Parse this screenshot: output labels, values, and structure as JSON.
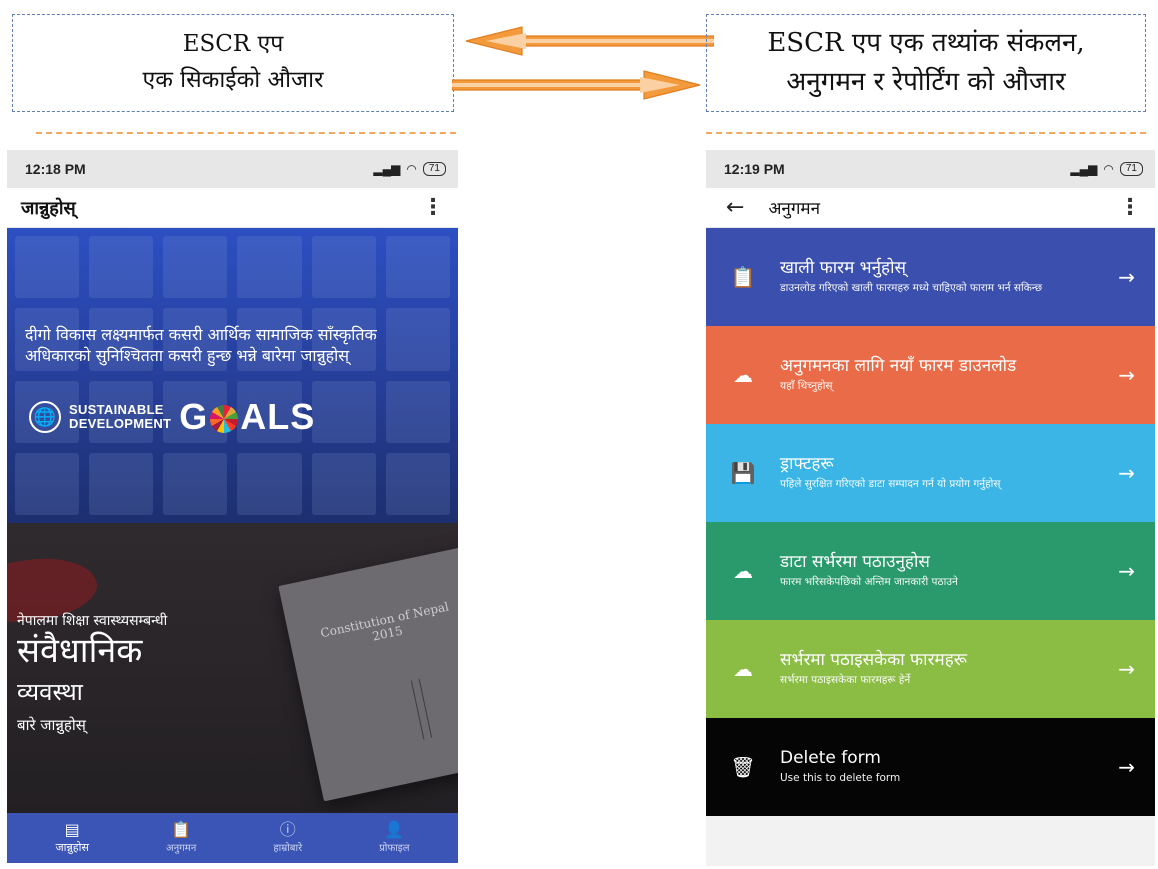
{
  "captions": {
    "left": {
      "line1": "ESCR एप",
      "line2": "एक सिकाईको औजार"
    },
    "right": {
      "line1": "ESCR एप एक तथ्यांक संकलन,",
      "line2": "अनुगमन र रेपोर्टिंग को औजार"
    }
  },
  "colors": {
    "arrow": "#f39a3c",
    "dashed_box": "#5f7fb5",
    "separator": "#f0a860"
  },
  "left_phone": {
    "status": {
      "time": "12:18 PM",
      "battery": "71"
    },
    "appbar": {
      "title": "जान्नुहोस्",
      "menu": "⋮"
    },
    "sdg_banner": {
      "text": "दीगो विकास लक्ष्यमार्फत कसरी आर्थिक सामाजिक साँस्कृतिक अधिकारको सुनिश्चितता कसरी हुन्छ भन्ने बारेमा जान्नुहोस्",
      "logo_line1": "SUSTAINABLE",
      "logo_line2": "DEVELOPMENT",
      "logo_big_a": "G",
      "logo_big_b": "ALS"
    },
    "constitution_banner": {
      "small": "नेपालमा शिक्षा स्वास्थ्यसम्बन्धी",
      "big": "संवैधानिक",
      "mid": "व्यवस्था",
      "foot": "बारे जान्नुहोस्",
      "book_title": "Constitution of Nepal 2015"
    },
    "bottom_nav": [
      {
        "label": "जान्नुहोस",
        "icon": "▤"
      },
      {
        "label": "अनुगमन",
        "icon": "📋"
      },
      {
        "label": "हाम्रोबारे",
        "icon": "ⓘ"
      },
      {
        "label": "प्रोफाइल",
        "icon": "👤"
      }
    ]
  },
  "right_phone": {
    "status": {
      "time": "12:19 PM",
      "battery": "71"
    },
    "appbar": {
      "back": "←",
      "title": "अनुगमन",
      "menu": "⋮"
    },
    "menu": [
      {
        "title": "खाली फारम भर्नुहोस्",
        "subtitle": "डाउनलोड गरिएको खाली फारमहरु मध्ये चाहिएको फाराम भर्न सकिन्छ",
        "icon": "📋",
        "color": "#3b4fae",
        "arrow": "→"
      },
      {
        "title": "अनुगमनका लागि नयाँ फारम डाउनलोड",
        "subtitle": "यहाँ थिच्नुहोस्",
        "icon": "☁",
        "color": "#ea6b48",
        "arrow": "→"
      },
      {
        "title": "ड्राफ्टहरू",
        "subtitle": "पहिले सुरक्षित गरिएको डाटा सम्पादन गर्न यो प्रयोग गर्नुहोस्",
        "icon": "💾",
        "color": "#3ab5e6",
        "arrow": "→"
      },
      {
        "title": "डाटा सर्भरमा पठाउनुहोस",
        "subtitle": "फारम भरिसकेपछिको अन्तिम जानकारी पठाउने",
        "icon": "☁",
        "color": "#2a9a6c",
        "arrow": "→"
      },
      {
        "title": "सर्भरमा पठाइसकेका फारमहरू",
        "subtitle": "सर्भरमा पठाइसकेका फारमहरू हेर्ने",
        "icon": "☁",
        "color": "#8bbd45",
        "arrow": "→"
      },
      {
        "title": "Delete form",
        "subtitle": "Use this to delete form",
        "icon": "🗑",
        "color": "#050505",
        "arrow": "→"
      }
    ]
  }
}
